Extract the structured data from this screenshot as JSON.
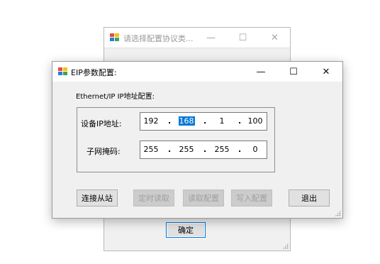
{
  "bg_window": {
    "title": "请选择配置协议类...",
    "minimize_glyph": "—",
    "maximize_glyph": "☐",
    "close_glyph": "✕",
    "ok_button": "确定"
  },
  "dialog": {
    "title": "EIP参数配置:",
    "minimize_glyph": "—",
    "maximize_glyph": "☐",
    "close_glyph": "✕",
    "group_label": "Ethernet/IP IP地址配置:",
    "device_ip": {
      "label": "设备IP地址:",
      "octets": [
        "192",
        "168",
        "1",
        "100"
      ],
      "selected_octet": "168"
    },
    "subnet_mask": {
      "label": "子网掩码:",
      "octets": [
        "255",
        "255",
        "255",
        "0"
      ]
    },
    "dot_glyph": ".",
    "buttons": {
      "connect": "连接从站",
      "timed_read": "定时读取",
      "read_config": "读取配置",
      "write_config": "写入配置",
      "exit": "退出"
    }
  },
  "icon_colors": [
    "#e84c3d",
    "#f4c20d",
    "#2e7bd6",
    "#3aa655"
  ]
}
